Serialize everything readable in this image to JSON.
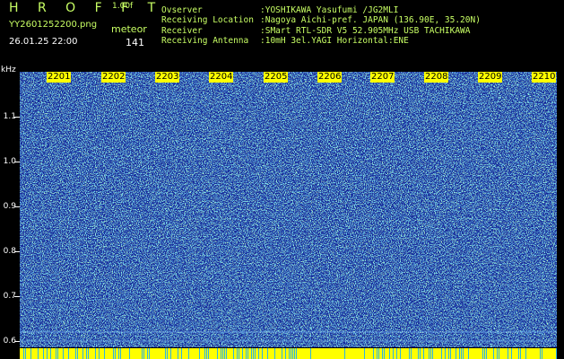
{
  "header": {
    "app_name": "H R O F F T",
    "version": "1.00f",
    "filename": "YY2601252200.png",
    "meteor_label": "meteor",
    "datetime": "26.01.25 22:00",
    "meteor_count": "141",
    "info": [
      {
        "key": "Ovserver",
        "value": ":YOSHIKAWA Yasufumi /JG2MLI"
      },
      {
        "key": "Receiving Location",
        "value": ":Nagoya Aichi-pref. JAPAN (136.90E, 35.20N)"
      },
      {
        "key": "Receiver",
        "value": ":SMart RTL-SDR V5 52.905MHz USB TACHIKAWA"
      },
      {
        "key": "Receiving Antenna",
        "value": ":10mH 3el.YAGI Horizontal:ENE"
      }
    ]
  },
  "axis": {
    "unit": "kHz",
    "y_ticks": [
      "1.1",
      "1.0",
      "0.9",
      "0.8",
      "0.7",
      "0.6"
    ],
    "time_labels": [
      "2201",
      "2202",
      "2203",
      "2204",
      "2205",
      "2206",
      "2207",
      "2208",
      "2209",
      "2210"
    ]
  },
  "colors": {
    "background": "#000000",
    "noise_base": "#1a2fb4",
    "noise_mid": "#2bb4e6",
    "noise_high": "#96ff78",
    "label_bg": "#ffff00",
    "text_green": "#c8ff64"
  }
}
